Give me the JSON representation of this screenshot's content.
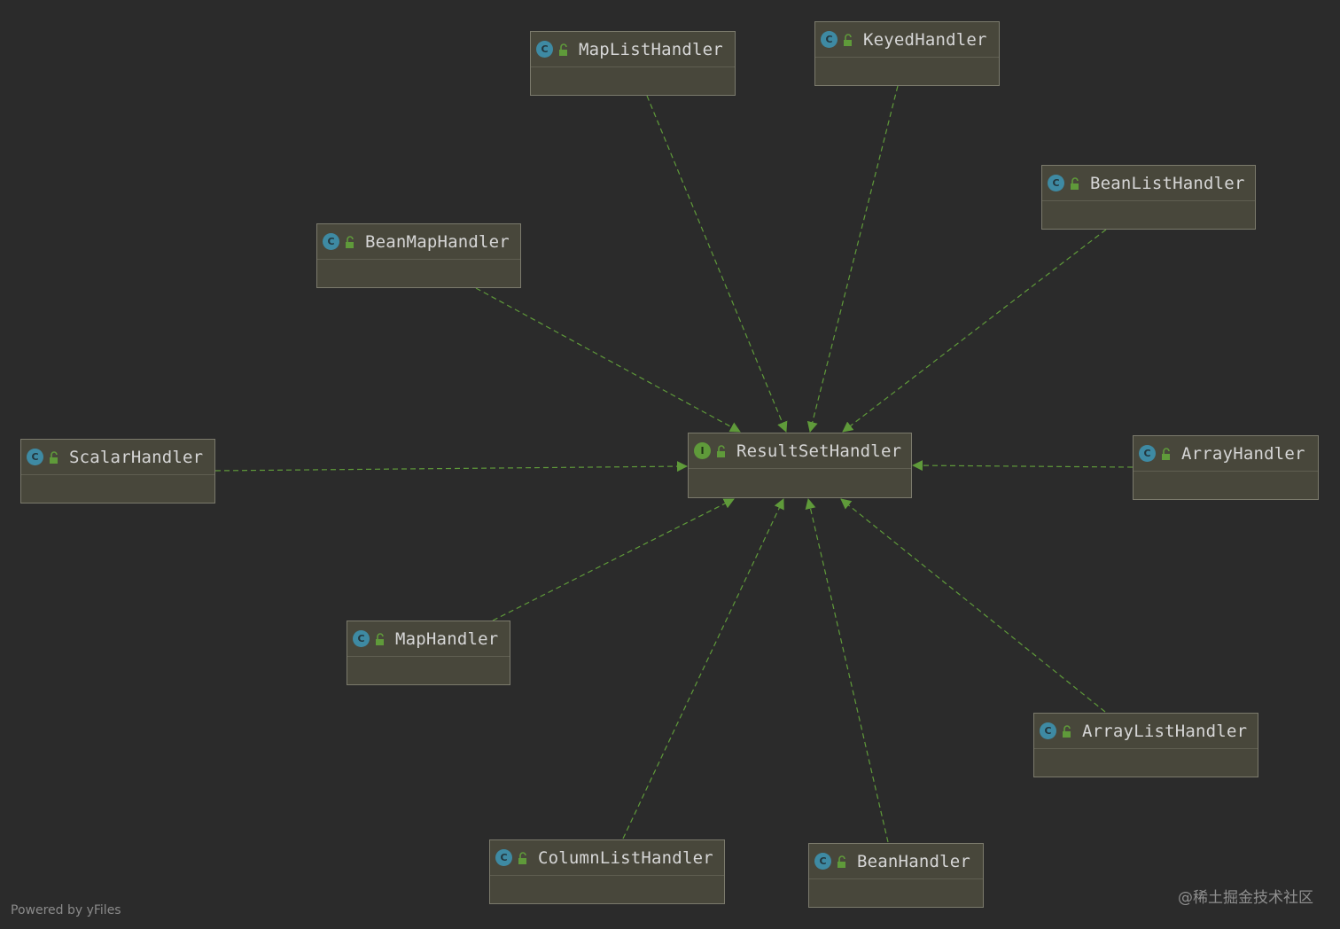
{
  "diagram": {
    "nodes": [
      {
        "id": "result",
        "label": "ResultSetHandler",
        "kind": "interface",
        "badge": "I"
      },
      {
        "id": "maplist",
        "label": "MapListHandler",
        "kind": "class",
        "badge": "C"
      },
      {
        "id": "keyed",
        "label": "KeyedHandler",
        "kind": "class",
        "badge": "C"
      },
      {
        "id": "beanlist",
        "label": "BeanListHandler",
        "kind": "class",
        "badge": "C"
      },
      {
        "id": "beanmap",
        "label": "BeanMapHandler",
        "kind": "class",
        "badge": "C"
      },
      {
        "id": "scalar",
        "label": "ScalarHandler",
        "kind": "class",
        "badge": "C"
      },
      {
        "id": "array",
        "label": "ArrayHandler",
        "kind": "class",
        "badge": "C"
      },
      {
        "id": "map",
        "label": "MapHandler",
        "kind": "class",
        "badge": "C"
      },
      {
        "id": "arraylist",
        "label": "ArrayListHandler",
        "kind": "class",
        "badge": "C"
      },
      {
        "id": "columnlist",
        "label": "ColumnListHandler",
        "kind": "class",
        "badge": "C"
      },
      {
        "id": "bean",
        "label": "BeanHandler",
        "kind": "class",
        "badge": "C"
      }
    ],
    "edges": [
      {
        "from": "maplist",
        "to": "result",
        "type": "implements"
      },
      {
        "from": "keyed",
        "to": "result",
        "type": "implements"
      },
      {
        "from": "beanlist",
        "to": "result",
        "type": "implements"
      },
      {
        "from": "beanmap",
        "to": "result",
        "type": "implements"
      },
      {
        "from": "scalar",
        "to": "result",
        "type": "implements"
      },
      {
        "from": "array",
        "to": "result",
        "type": "implements"
      },
      {
        "from": "map",
        "to": "result",
        "type": "implements"
      },
      {
        "from": "arraylist",
        "to": "result",
        "type": "implements"
      },
      {
        "from": "columnlist",
        "to": "result",
        "type": "implements"
      },
      {
        "from": "bean",
        "to": "result",
        "type": "implements"
      }
    ]
  },
  "colors": {
    "background": "#2b2b2b",
    "node_fill": "#48473b",
    "edge": "#5f9a3a",
    "class_badge": "#3e8aa3",
    "interface_badge": "#5f9a3a"
  },
  "footer": {
    "text": "Powered by yFiles"
  },
  "watermark": {
    "text": "@稀土掘金技术社区"
  }
}
